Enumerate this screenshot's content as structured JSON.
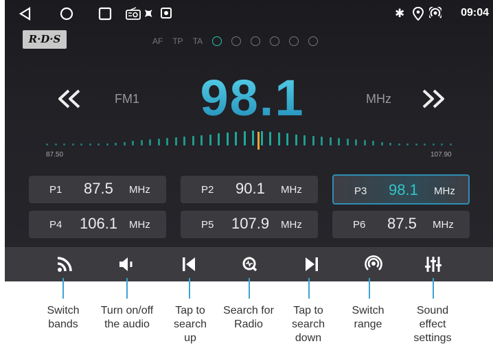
{
  "status_bar": {
    "time": "09:04"
  },
  "rds_label": "R·D·S",
  "flags": [
    "AF",
    "TP",
    "TA"
  ],
  "band": "FM1",
  "frequency": "98.1",
  "frequency_unit": "MHz",
  "scale": {
    "min_label": "87.50",
    "max_label": "107.90",
    "current": 98.1
  },
  "presets": [
    {
      "num": "P1",
      "value": "87.5",
      "unit": "MHz"
    },
    {
      "num": "P2",
      "value": "90.1",
      "unit": "MHz"
    },
    {
      "num": "P3",
      "value": "98.1",
      "unit": "MHz",
      "active": true
    },
    {
      "num": "P4",
      "value": "106.1",
      "unit": "MHz"
    },
    {
      "num": "P5",
      "value": "107.9",
      "unit": "MHz"
    },
    {
      "num": "P6",
      "value": "87.5",
      "unit": "MHz"
    }
  ],
  "captions": [
    {
      "text": "Switch\nbands"
    },
    {
      "text": "Turn on/off\nthe audio"
    },
    {
      "text": "Tap to\nsearch\nup"
    },
    {
      "text": "Search for\nRadio"
    },
    {
      "text": "Tap to\nsearch\ndown"
    },
    {
      "text": "Switch\nrange"
    },
    {
      "text": "Sound\neffect\nsettings"
    }
  ],
  "colors": {
    "accent": "#33a9c9",
    "tick": "#1fae9e",
    "needle": "#f3a33a",
    "annotation_line": "#3aa3d6"
  }
}
